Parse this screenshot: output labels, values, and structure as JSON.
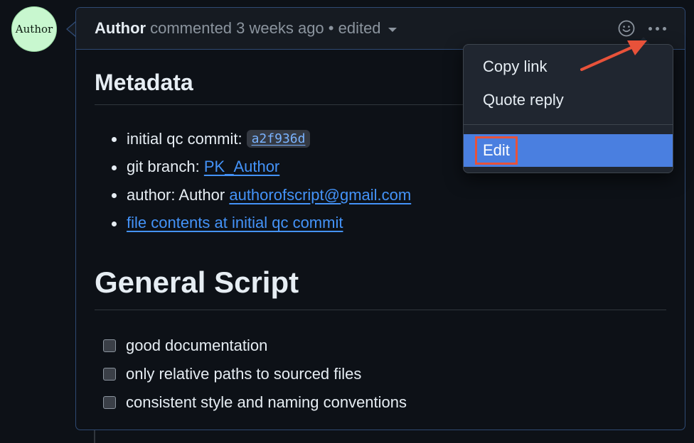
{
  "avatar": {
    "label": "Author",
    "color": "#c8f7cf"
  },
  "comment": {
    "author": "Author",
    "meta": "commented 3 weeks ago • edited",
    "emoji_icon": "smiley-icon",
    "more_icon": "kebab-horizontal-icon"
  },
  "body": {
    "metadata_heading": "Metadata",
    "metadata_items": {
      "commit_label": "initial qc commit:",
      "commit_sha": "a2f936d",
      "branch_label": "git branch:",
      "branch_value": "PK_Author",
      "author_label": "author: Author",
      "author_email": "authorofscript@gmail.com",
      "file_contents_link": "file contents at initial qc commit"
    },
    "general_heading": "General Script",
    "checklist": [
      "good documentation",
      "only relative paths to sourced files",
      "consistent style and naming conventions"
    ]
  },
  "menu": {
    "copy_link": "Copy link",
    "quote_reply": "Quote reply",
    "edit": "Edit",
    "highlight_color": "#4a7fe0"
  },
  "annotation": {
    "color": "#e8523a"
  },
  "colors": {
    "background": "#0d1117",
    "link": "#4493f8",
    "border": "#2f4a73"
  }
}
